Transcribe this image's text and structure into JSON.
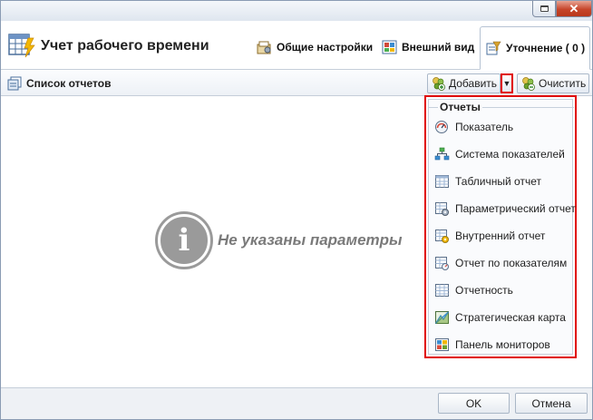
{
  "window": {
    "close_glyph": "✕",
    "minimize_icon": "minimize-icon"
  },
  "header": {
    "title": "Учет рабочего времени",
    "tabs": [
      {
        "label": "Общие настройки",
        "icon": "settings-icon"
      },
      {
        "label": "Внешний вид",
        "icon": "appearance-icon"
      },
      {
        "label": "Уточнение ( 0 )",
        "icon": "filter-icon"
      }
    ]
  },
  "toolbar": {
    "list_label": "Список отчетов",
    "add_label": "Добавить",
    "dropdown_glyph": "▼",
    "clear_label": "Очистить"
  },
  "content": {
    "info_glyph": "i",
    "message": "Не указаны параметры"
  },
  "dropdown": {
    "header": "Отчеты",
    "items": [
      {
        "label": "Показатель",
        "icon": "indicator-icon"
      },
      {
        "label": "Система показателей",
        "icon": "indicator-system-icon"
      },
      {
        "label": "Табличный отчет",
        "icon": "table-report-icon"
      },
      {
        "label": "Параметрический отчет",
        "icon": "parametric-report-icon"
      },
      {
        "label": "Внутренний отчет",
        "icon": "internal-report-icon"
      },
      {
        "label": "Отчет по показателям",
        "icon": "indicator-report-icon"
      },
      {
        "label": "Отчетность",
        "icon": "reporting-icon"
      },
      {
        "label": "Стратегическая карта",
        "icon": "strategy-map-icon"
      },
      {
        "label": "Панель мониторов",
        "icon": "dashboard-icon"
      }
    ]
  },
  "footer": {
    "ok_label": "OK",
    "cancel_label": "Отмена"
  },
  "colors": {
    "highlight": "#e00000",
    "border": "#8a9bb3",
    "accent_green": "#6aa02c"
  }
}
